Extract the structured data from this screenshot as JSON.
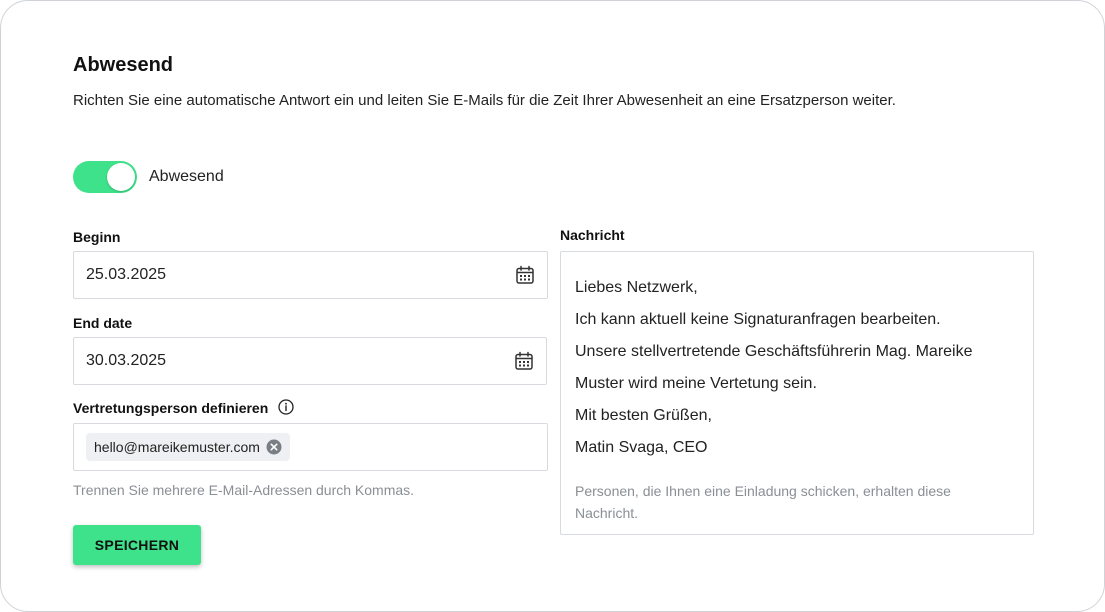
{
  "header": {
    "title": "Abwesend",
    "description": "Richten Sie eine automatische Antwort ein und leiten Sie E-Mails für die Zeit Ihrer Abwesenheit an eine Ersatzperson weiter."
  },
  "toggle": {
    "label": "Abwesend",
    "on": true
  },
  "begin": {
    "label": "Beginn",
    "value": "25.03.2025",
    "icon": "calendar-icon"
  },
  "end": {
    "label": "End date",
    "value": "30.03.2025",
    "icon": "calendar-icon"
  },
  "substitute": {
    "label": "Vertretungsperson definieren",
    "info_icon": "info-icon",
    "chips": [
      "hello@mareikemuster.com"
    ],
    "hint": "Trennen Sie mehrere E-Mail-Adressen durch Kommas."
  },
  "save_label": "SPEICHERN",
  "message": {
    "label": "Nachricht",
    "lines": [
      "Liebes Netzwerk,",
      "Ich kann aktuell keine Signaturanfragen bearbeiten.",
      "Unsere stellvertretende Geschäftsführerin Mag. Mareike Muster wird meine Vertetung sein.",
      "Mit besten Grüßen,",
      "Matin Svaga, CEO"
    ],
    "note": "Personen, die Ihnen eine Einladung schicken, erhalten diese Nachricht."
  },
  "colors": {
    "accent": "#3ee28a",
    "border": "#d7dbe0",
    "hint": "#8a8f96"
  }
}
